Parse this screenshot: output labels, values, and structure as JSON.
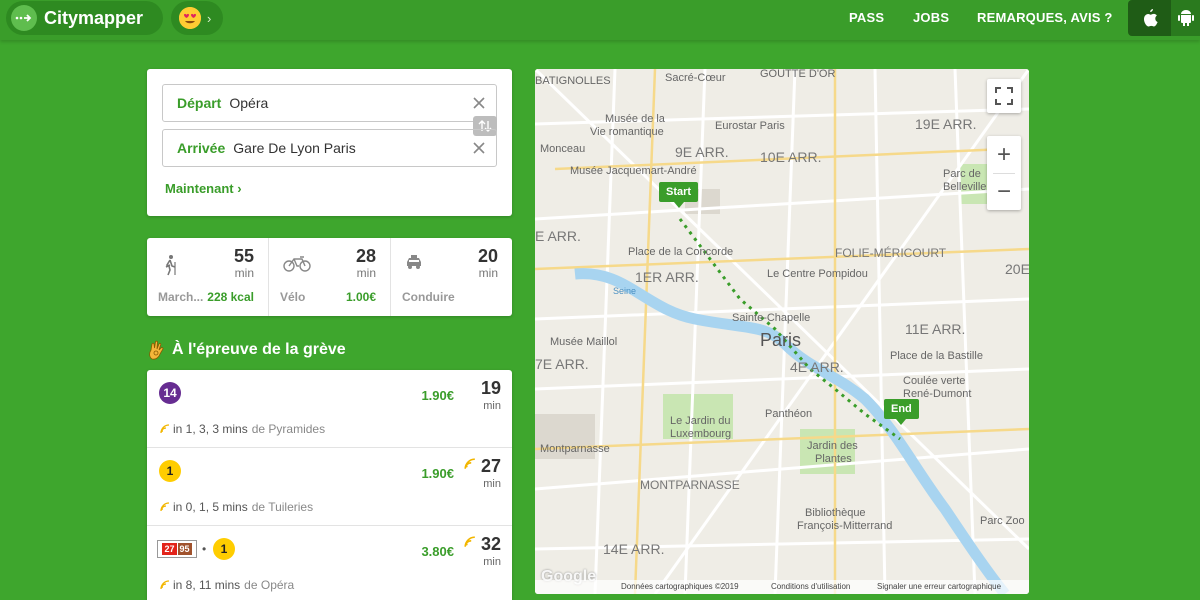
{
  "header": {
    "brand": "Citymapper",
    "nav": [
      "PASS",
      "JOBS",
      "REMARQUES, AVIS ?"
    ],
    "icons": [
      "arrow-dots-icon",
      "smiley-hearts-icon",
      "apple-icon",
      "android-icon"
    ]
  },
  "search": {
    "departure_label": "Départ",
    "departure_value": "Opéra",
    "arrival_label": "Arrivée",
    "arrival_value": "Gare De Lyon Paris",
    "time_label": "Maintenant"
  },
  "modes": [
    {
      "icon": "walk-icon",
      "minutes": "55",
      "unit": "min",
      "name": "March...",
      "extra": "228 kcal"
    },
    {
      "icon": "bike-icon",
      "minutes": "28",
      "unit": "min",
      "name": "Vélo",
      "extra": "1.00€"
    },
    {
      "icon": "taxi-icon",
      "minutes": "20",
      "unit": "min",
      "name": "Conduire",
      "extra": ""
    }
  ],
  "strike": {
    "title": "À l'épreuve de la grève"
  },
  "routes": [
    {
      "line": "14",
      "price": "1.90€",
      "duration": "19",
      "unit": "min",
      "next": "in 1, 3, 3 mins",
      "stop_prefix": "de",
      "stop": "Pyramides"
    },
    {
      "line": "1",
      "price": "1.90€",
      "duration": "27",
      "unit": "min",
      "next": "in 0, 1, 5 mins",
      "stop_prefix": "de",
      "stop": "Tuileries"
    },
    {
      "bus_a": "27",
      "bus_b": "95",
      "sep": "•",
      "line": "1",
      "price": "3.80€",
      "duration": "32",
      "unit": "min",
      "next": "in 8, 11 mins",
      "stop_prefix": "de",
      "stop": "Opéra"
    }
  ],
  "colors": {
    "brand_green": "#3a9d2a",
    "line14": "#662c91",
    "line1": "#ffcd00",
    "bus27": "#e2231a",
    "bus95": "#a0522d"
  },
  "map": {
    "labels": [
      "BATIGNOLLES",
      "Sacré-Cœur",
      "GOUTTE D'OR",
      "Musée de la",
      "Vie romantique",
      "Eurostar Paris",
      "19E ARR.",
      "9E ARR.",
      "10E ARR.",
      "Monceau",
      "Musée Jacquemart-André",
      "Parc de",
      "Belleville",
      "E ARR.",
      "Place de la Concorde",
      "FOLIE-MÉRICOURT",
      "1ER ARR.",
      "Le Centre Pompidou",
      "20E",
      "Seine",
      "Sainte-Chapelle",
      "11E ARR.",
      "Musée Maillol",
      "Paris",
      "Place de la Bastille",
      "7E ARR.",
      "4E ARR.",
      "Coulée verte",
      "René-Dumont",
      "Panthéon",
      "Le Jardin du",
      "Luxembourg",
      "Montparnasse",
      "Jardin des",
      "Plantes",
      "MONTPARNASSE",
      "Bibliothèque",
      "François-Mitterrand",
      "Parc Zoo",
      "14E ARR."
    ],
    "start_label": "Start",
    "end_label": "End",
    "footer_data": "Données cartographiques ©2019",
    "footer_terms": "Conditions d'utilisation",
    "footer_report": "Signaler une erreur cartographique",
    "google": "Google"
  }
}
